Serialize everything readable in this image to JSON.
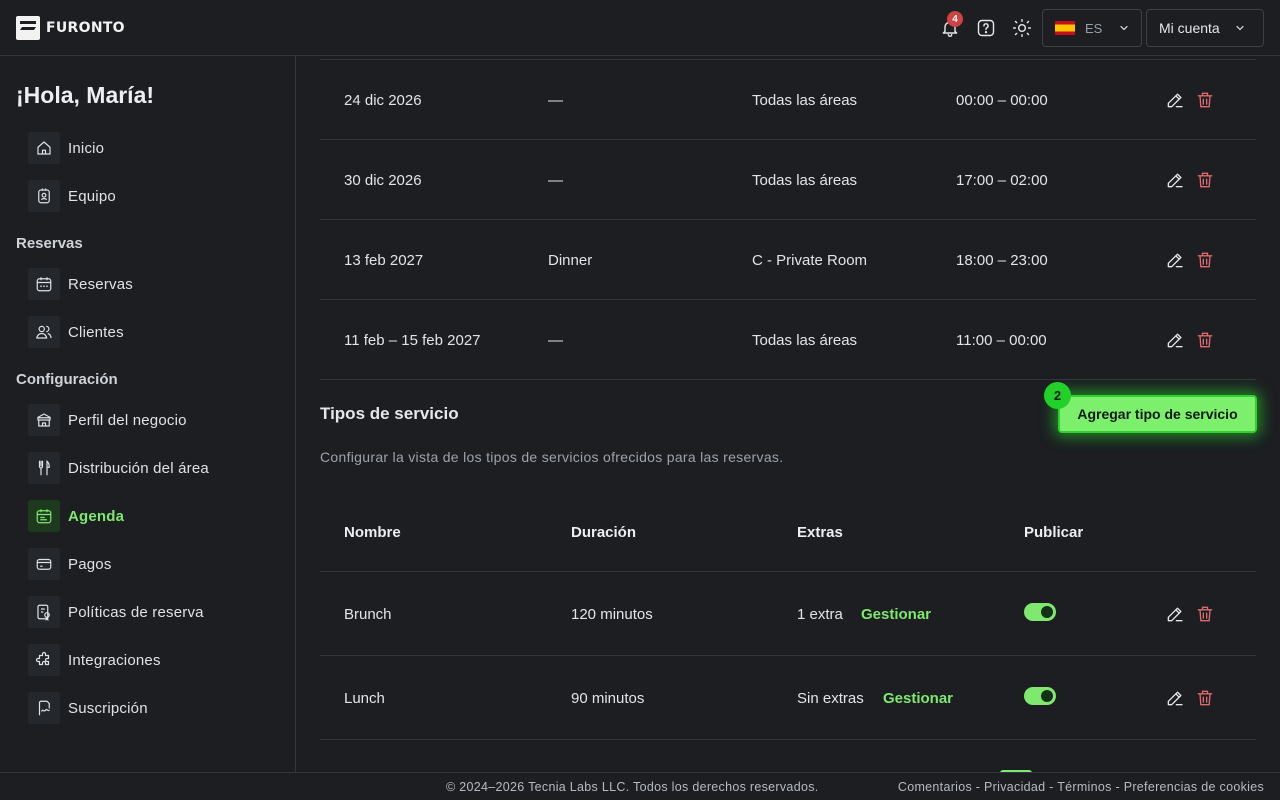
{
  "header": {
    "brand": "FURONTO",
    "notifications_count": "4",
    "language_code": "ES",
    "account_label": "Mi cuenta",
    "icons": [
      "bell-icon",
      "help-icon",
      "sun-icon",
      "spain-flag-icon",
      "chevron-down-icon"
    ]
  },
  "sidebar": {
    "greeting": "¡Hola, María!",
    "items_top": [
      {
        "label": "Inicio",
        "icon": "home-icon"
      },
      {
        "label": "Equipo",
        "icon": "badge-icon"
      }
    ],
    "section_reservas": "Reservas",
    "items_reservas": [
      {
        "label": "Reservas",
        "icon": "calendar-icon"
      },
      {
        "label": "Clientes",
        "icon": "users-icon"
      }
    ],
    "section_config": "Configuración",
    "items_config": [
      {
        "label": "Perfil del negocio",
        "icon": "store-icon"
      },
      {
        "label": "Distribución del área",
        "icon": "cutlery-icon"
      },
      {
        "label": "Agenda",
        "icon": "schedule-icon",
        "active": true
      },
      {
        "label": "Pagos",
        "icon": "card-icon"
      },
      {
        "label": "Políticas de reserva",
        "icon": "policy-icon"
      },
      {
        "label": "Integraciones",
        "icon": "puzzle-icon"
      },
      {
        "label": "Suscripción",
        "icon": "signature-icon"
      }
    ]
  },
  "schedule_rows": [
    {
      "date": "24 dic 2026",
      "service": "—",
      "area": "Todas las áreas",
      "hours": "00:00 – 00:00"
    },
    {
      "date": "30 dic 2026",
      "service": "—",
      "area": "Todas las áreas",
      "hours": "17:00 – 02:00"
    },
    {
      "date": "13 feb 2027",
      "service": "Dinner",
      "area": "C - Private Room",
      "hours": "18:00 – 23:00"
    },
    {
      "date": "11 feb – 15 feb 2027",
      "service": "—",
      "area": "Todas las áreas",
      "hours": "11:00 – 00:00"
    }
  ],
  "service_types": {
    "title": "Tipos de servicio",
    "description": "Configurar la vista de los tipos de servicios ofrecidos para las reservas.",
    "add_button": "Agregar tipo de servicio",
    "step_badge": "2",
    "columns": [
      "Nombre",
      "Duración",
      "Extras",
      "Publicar"
    ],
    "rows": [
      {
        "name": "Brunch",
        "duration": "120 minutos",
        "extras": "1 extra",
        "manage": "Gestionar",
        "published": true
      },
      {
        "name": "Lunch",
        "duration": "90 minutos",
        "extras": "Sin extras",
        "manage": "Gestionar",
        "published": true
      }
    ]
  },
  "footer": {
    "copyright": "© 2024–2026 Tecnia Labs LLC. Todos los derechos reservados.",
    "links": "Comentarios - Privacidad - Términos - Preferencias de cookies"
  },
  "colors": {
    "accent": "#7ee86f",
    "background": "#1c1e22",
    "danger": "#e06a6a"
  }
}
